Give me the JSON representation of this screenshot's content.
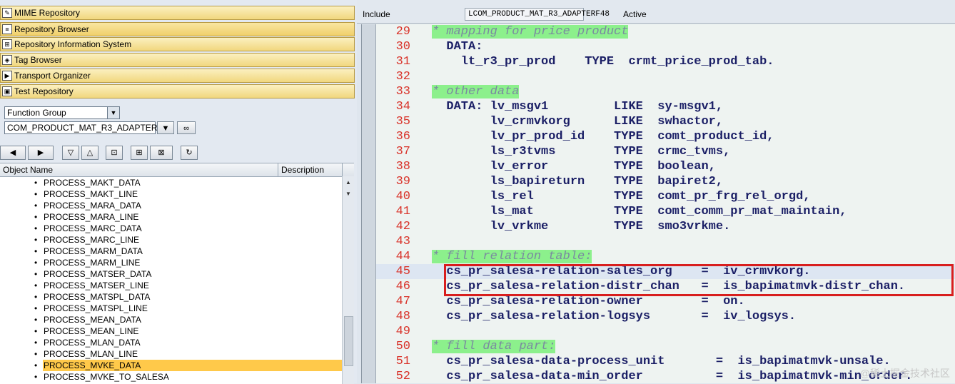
{
  "nav": {
    "mime": "MIME Repository",
    "repo_browser": "Repository Browser",
    "repo_info": "Repository Information System",
    "tag_browser": "Tag Browser",
    "transport": "Transport Organizer",
    "test_repo": "Test Repository"
  },
  "object_type": {
    "selected": "Function Group"
  },
  "object_name": {
    "value": "COM_PRODUCT_MAT_R3_ADAPTER"
  },
  "tree": {
    "col_object": "Object Name",
    "col_desc": "Description",
    "items": [
      "PROCESS_MAKT_DATA",
      "PROCESS_MAKT_LINE",
      "PROCESS_MARA_DATA",
      "PROCESS_MARA_LINE",
      "PROCESS_MARC_DATA",
      "PROCESS_MARC_LINE",
      "PROCESS_MARM_DATA",
      "PROCESS_MARM_LINE",
      "PROCESS_MATSER_DATA",
      "PROCESS_MATSER_LINE",
      "PROCESS_MATSPL_DATA",
      "PROCESS_MATSPL_LINE",
      "PROCESS_MEAN_DATA",
      "PROCESS_MEAN_LINE",
      "PROCESS_MLAN_DATA",
      "PROCESS_MLAN_LINE",
      "PROCESS_MVKE_DATA",
      "PROCESS_MVKE_TO_SALESA"
    ],
    "selected_item": "PROCESS_MVKE_DATA"
  },
  "header": {
    "label": "Include",
    "include_name": "LCOM_PRODUCT_MAT_R3_ADAPTERF48",
    "status": "Active"
  },
  "code": {
    "lines": [
      {
        "n": "29",
        "t": "* mapping for price product",
        "c": true
      },
      {
        "n": "30",
        "t": "  DATA:"
      },
      {
        "n": "31",
        "t": "    lt_r3_pr_prod    TYPE  crmt_price_prod_tab."
      },
      {
        "n": "32",
        "t": ""
      },
      {
        "n": "33",
        "t": "* other data",
        "c": true
      },
      {
        "n": "34",
        "t": "  DATA: lv_msgv1         LIKE  sy-msgv1,"
      },
      {
        "n": "35",
        "t": "        lv_crmvkorg      LIKE  swhactor,"
      },
      {
        "n": "36",
        "t": "        lv_pr_prod_id    TYPE  comt_product_id,"
      },
      {
        "n": "37",
        "t": "        ls_r3tvms        TYPE  crmc_tvms,"
      },
      {
        "n": "38",
        "t": "        lv_error         TYPE  boolean,"
      },
      {
        "n": "39",
        "t": "        ls_bapireturn    TYPE  bapiret2,"
      },
      {
        "n": "40",
        "t": "        ls_rel           TYPE  comt_pr_frg_rel_orgd,"
      },
      {
        "n": "41",
        "t": "        ls_mat           TYPE  comt_comm_pr_mat_maintain,"
      },
      {
        "n": "42",
        "t": "        lv_vrkme         TYPE  smo3vrkme."
      },
      {
        "n": "43",
        "t": ""
      },
      {
        "n": "44",
        "t": "* fill relation table:",
        "c": true
      },
      {
        "n": "45",
        "t": "  cs_pr_salesa-relation-sales_org    =  iv_crmvkorg.",
        "h": true
      },
      {
        "n": "46",
        "t": "  cs_pr_salesa-relation-distr_chan   =  is_bapimatmvk-distr_chan."
      },
      {
        "n": "47",
        "t": "  cs_pr_salesa-relation-owner        =  on."
      },
      {
        "n": "48",
        "t": "  cs_pr_salesa-relation-logsys       =  iv_logsys."
      },
      {
        "n": "49",
        "t": ""
      },
      {
        "n": "50",
        "t": "* fill data part:",
        "c": true
      },
      {
        "n": "51",
        "t": "  cs_pr_salesa-data-process_unit       =  is_bapimatmvk-unsale."
      },
      {
        "n": "52",
        "t": "  cs_pr_salesa-data-min_order          =  is_bapimatmvk-min_order."
      }
    ]
  },
  "watermark": "@稀土掘金技术社区"
}
